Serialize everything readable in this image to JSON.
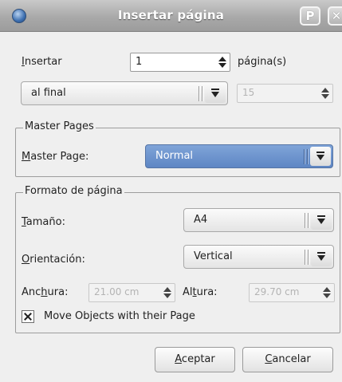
{
  "window": {
    "title": "Insertar página"
  },
  "insert": {
    "label_u": "I",
    "label_rest": "nsertar",
    "count": "1",
    "unit_label": "página(s)",
    "position": "al final",
    "page_ref": "15"
  },
  "master_pages": {
    "group_title": "Master Pages",
    "label_u": "M",
    "label_rest": "aster Page:",
    "selected": "Normal"
  },
  "page_format": {
    "group_title": "Formato de página",
    "size_label_u": "T",
    "size_label_rest": "amaño:",
    "size_value": "A4",
    "orientation_label_u": "O",
    "orientation_label_rest": "rientación:",
    "orientation_value": "Vertical",
    "width_label_a": "Anc",
    "width_label_u": "h",
    "width_label_b": "ura:",
    "width_value": "21.00 cm",
    "height_label_a": "Al",
    "height_label_u": "t",
    "height_label_b": "ura:",
    "height_value": "29.70 cm",
    "move_objects_label": "Move Objects with their Page",
    "move_objects_checked": true
  },
  "buttons": {
    "ok_u": "A",
    "ok_rest": "ceptar",
    "cancel_u": "C",
    "cancel_rest": "ancelar"
  },
  "titlebar_buttons": {
    "help_glyph": "P",
    "close_glyph": "✕"
  },
  "colors": {
    "selection": "#6a8fcd",
    "titlebar": "#b0b0b0"
  }
}
